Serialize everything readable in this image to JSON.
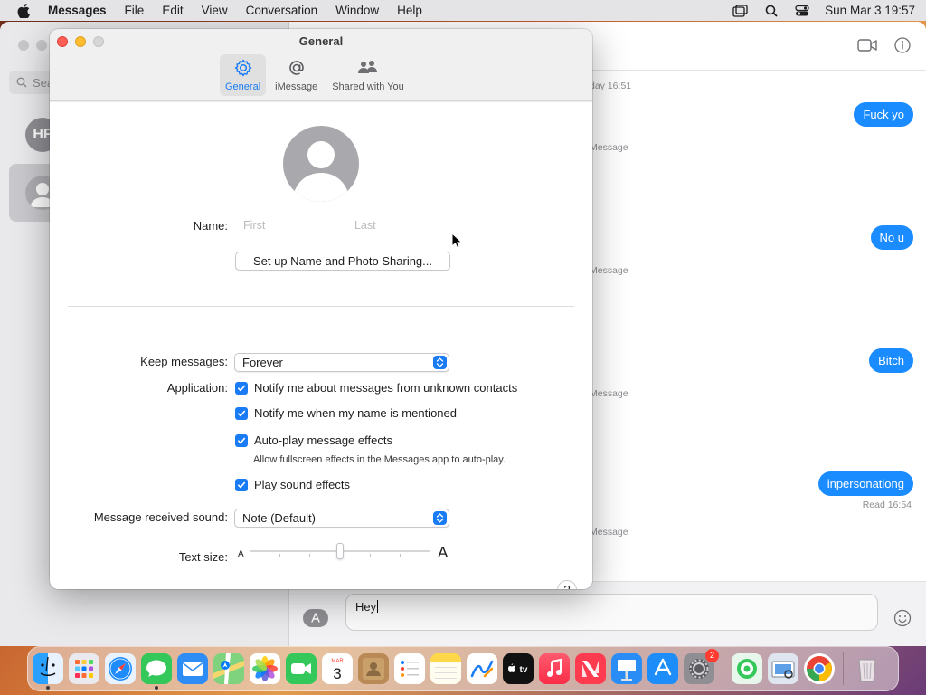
{
  "menubar": {
    "app_name": "Messages",
    "menus": [
      "File",
      "Edit",
      "View",
      "Conversation",
      "Window",
      "Help"
    ],
    "clock": "Sun Mar 3  19:57"
  },
  "sidebar": {
    "search_placeholder": "Sea",
    "avatar_initials": "HF"
  },
  "transcript": {
    "timestamps": [
      "day 16:51",
      "Message",
      "Message",
      "Message",
      "Message"
    ],
    "bubbles": [
      "Fuck yo",
      "No u",
      "Bitch",
      "inpersonationg"
    ],
    "read_receipt": "Read 16:54"
  },
  "compose": {
    "text": "Hey",
    "apps_icon": "A"
  },
  "settings": {
    "title": "General",
    "tabs": [
      {
        "label": "General",
        "icon": "gear-icon"
      },
      {
        "label": "iMessage",
        "icon": "at-icon"
      },
      {
        "label": "Shared with You",
        "icon": "people-icon"
      }
    ],
    "name_label": "Name:",
    "first_placeholder": "First",
    "last_placeholder": "Last",
    "setup_button": "Set up Name and Photo Sharing...",
    "keep_label": "Keep messages:",
    "keep_value": "Forever",
    "application_label": "Application:",
    "checkboxes": [
      {
        "label": "Notify me about messages from unknown contacts",
        "checked": true
      },
      {
        "label": "Notify me when my name is mentioned",
        "checked": true
      },
      {
        "label": "Auto-play message effects",
        "checked": true
      },
      {
        "label": "Play sound effects",
        "checked": true
      }
    ],
    "autoplay_note": "Allow fullscreen effects in the Messages app to auto-play.",
    "sound_label": "Message received sound:",
    "sound_value": "Note (Default)",
    "text_size_label": "Text size:",
    "text_size_small": "A",
    "text_size_large": "A",
    "text_size_level": 0.5,
    "help_label": "?"
  },
  "dock": {
    "apps": [
      "Finder",
      "Launchpad",
      "Safari",
      "Messages",
      "Mail",
      "Maps",
      "Photos",
      "FaceTime",
      "Calendar",
      "Contacts",
      "Reminders",
      "Notes",
      "Freeform",
      "TV",
      "Music",
      "News",
      "Keynote",
      "App Store",
      "System Settings",
      "Find My",
      "Preview",
      "Chrome",
      "Trash"
    ],
    "calendar_month": "MAR",
    "calendar_day": "3",
    "tv_label": "tv",
    "settings_badge": "2"
  },
  "colors": {
    "accent": "#1a7cf5",
    "bubble": "#1a8cff",
    "close": "#ff5f57",
    "minimize": "#febc2e"
  }
}
